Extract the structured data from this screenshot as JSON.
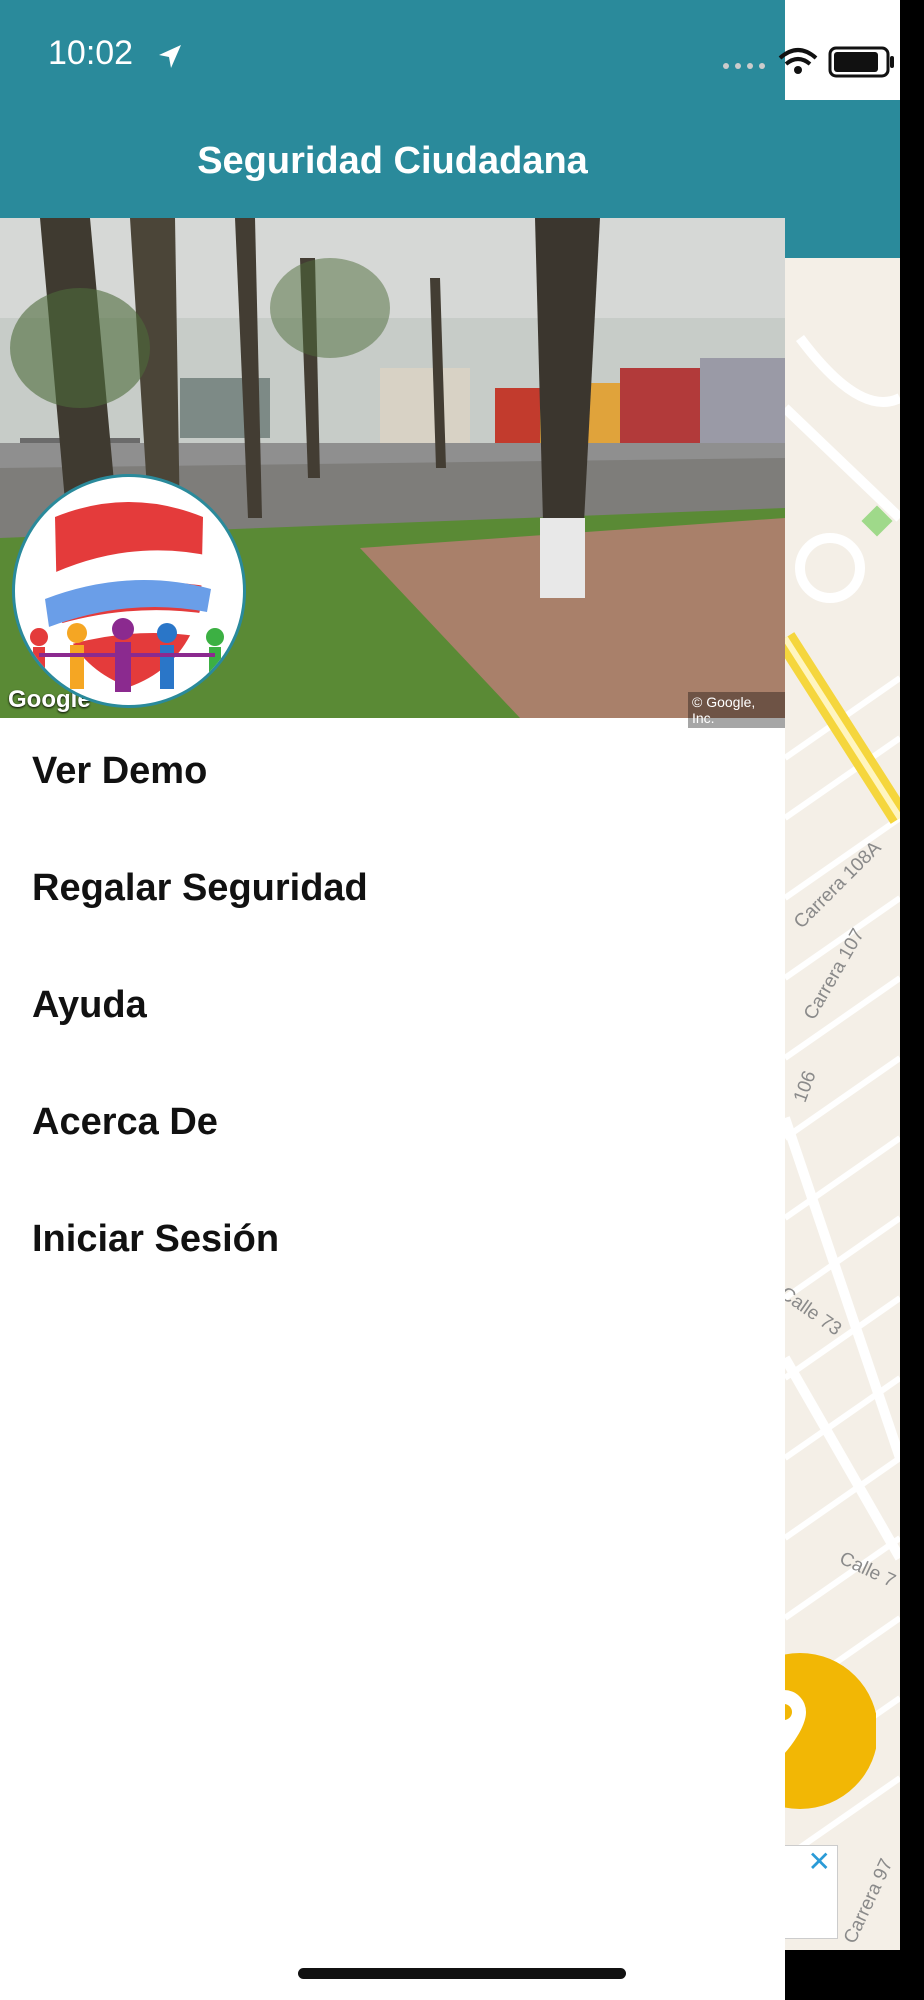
{
  "status_bar": {
    "time": "10:02"
  },
  "drawer": {
    "title": "Seguridad Ciudadana",
    "photo_watermark": "Google",
    "photo_credit": "© Google, Inc.",
    "menu": [
      {
        "label": "Ver Demo"
      },
      {
        "label": "Regalar Seguridad"
      },
      {
        "label": "Ayuda"
      },
      {
        "label": "Acerca De"
      },
      {
        "label": "Iniciar Sesión"
      }
    ]
  },
  "map": {
    "street_labels": [
      "Carrera 108A",
      "Carrera 107",
      "106",
      "Calle 73",
      "Calle 7",
      "Carrera 97"
    ]
  },
  "colors": {
    "header": "#2a8a9b",
    "fab": "#f2b705",
    "highway": "#f5d63d"
  }
}
